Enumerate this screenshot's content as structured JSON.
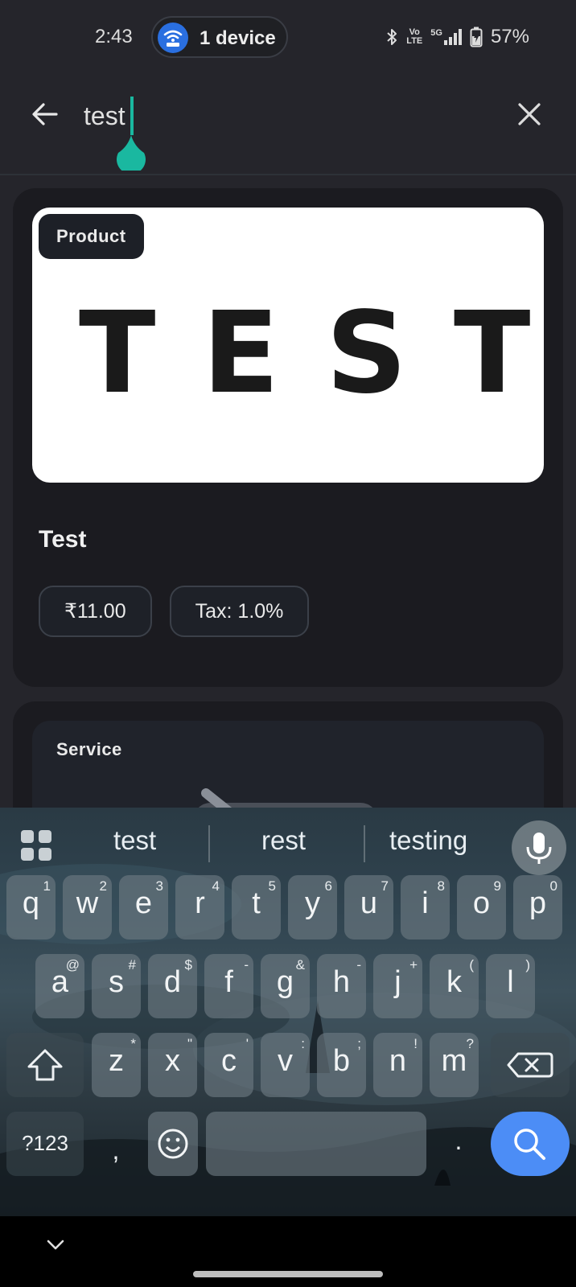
{
  "status_bar": {
    "time": "2:43",
    "hotspot_label": "1 device",
    "network_volte": [
      "Vo",
      "LTE"
    ],
    "network_5g": "5G",
    "battery": "57%"
  },
  "search": {
    "query": "test",
    "accent": "#1ab8a0"
  },
  "results": [
    {
      "type_label": "Product",
      "image_text": "TEST",
      "title": "Test",
      "price": "₹11.00",
      "tax": "Tax: 1.0%"
    },
    {
      "type_label": "Service"
    }
  ],
  "keyboard": {
    "suggestions": [
      "test",
      "rest",
      "testing"
    ],
    "row1": [
      {
        "k": "q",
        "s": "1"
      },
      {
        "k": "w",
        "s": "2"
      },
      {
        "k": "e",
        "s": "3"
      },
      {
        "k": "r",
        "s": "4"
      },
      {
        "k": "t",
        "s": "5"
      },
      {
        "k": "y",
        "s": "6"
      },
      {
        "k": "u",
        "s": "7"
      },
      {
        "k": "i",
        "s": "8"
      },
      {
        "k": "o",
        "s": "9"
      },
      {
        "k": "p",
        "s": "0"
      }
    ],
    "row2": [
      {
        "k": "a",
        "s": "@"
      },
      {
        "k": "s",
        "s": "#"
      },
      {
        "k": "d",
        "s": "$"
      },
      {
        "k": "f",
        "s": "-"
      },
      {
        "k": "g",
        "s": "&"
      },
      {
        "k": "h",
        "s": "-"
      },
      {
        "k": "j",
        "s": "+"
      },
      {
        "k": "k",
        "s": "("
      },
      {
        "k": "l",
        "s": ")"
      }
    ],
    "row3": [
      {
        "k": "z",
        "s": "*"
      },
      {
        "k": "x",
        "s": "\""
      },
      {
        "k": "c",
        "s": "'"
      },
      {
        "k": "v",
        "s": ":"
      },
      {
        "k": "b",
        "s": ";"
      },
      {
        "k": "n",
        "s": "!"
      },
      {
        "k": "m",
        "s": "?"
      }
    ],
    "symbols_label": "?123",
    "comma_label": ",",
    "period_label": ".",
    "search_key_color": "#4c8df6"
  }
}
